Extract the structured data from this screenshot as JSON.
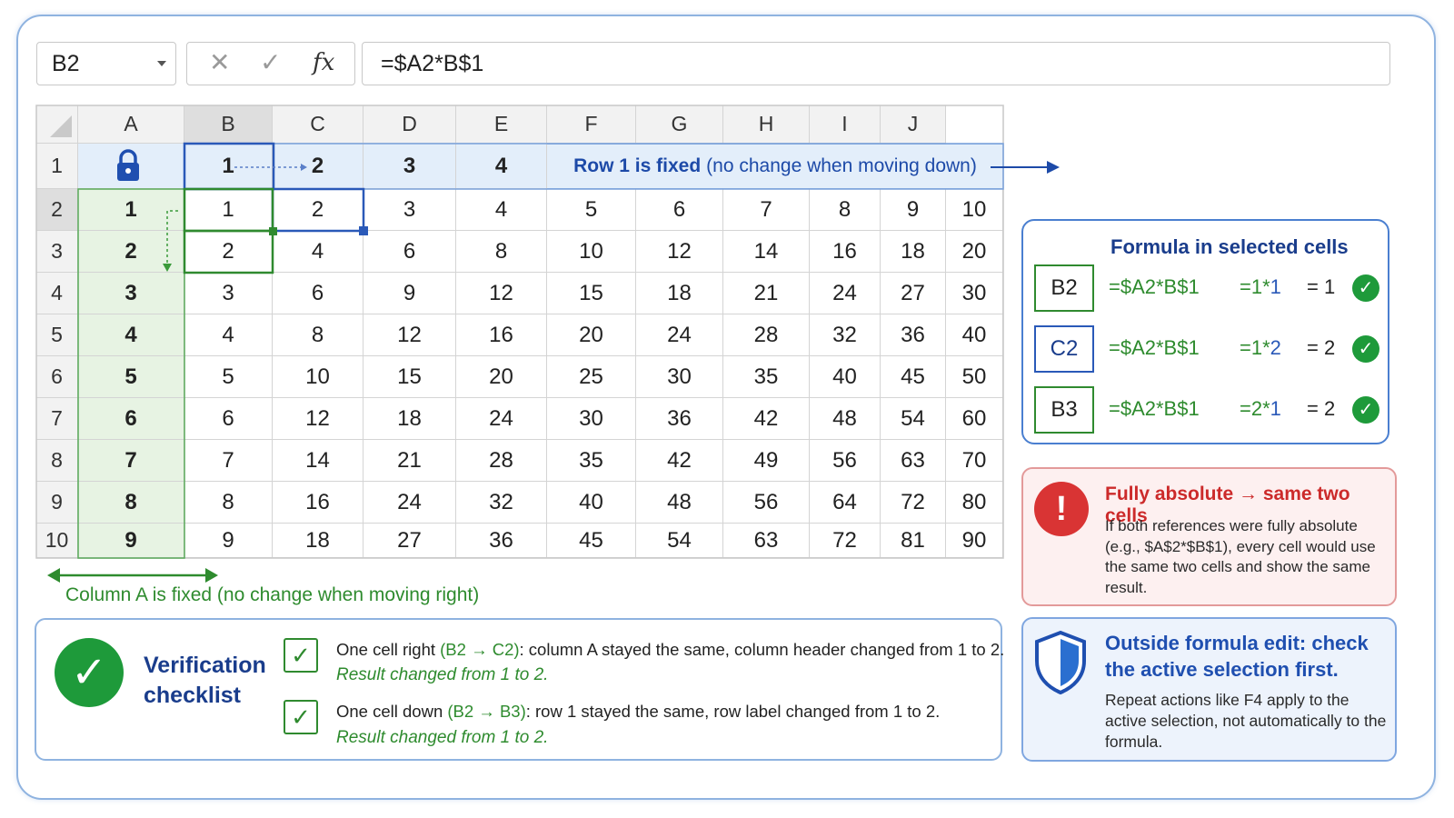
{
  "formula_bar": {
    "name_box": "B2",
    "cancel_icon": "✕",
    "enter_icon": "✓",
    "fx_label": "fx",
    "formula": "=$A2*B$1"
  },
  "grid": {
    "column_headers": [
      "A",
      "B",
      "C",
      "D",
      "E",
      "F",
      "G",
      "H",
      "I",
      "J"
    ],
    "row_headers": [
      "1",
      "2",
      "3",
      "4",
      "5",
      "6",
      "7",
      "8",
      "9",
      "10"
    ],
    "row1_values": [
      "1",
      "2",
      "3",
      "4"
    ],
    "row1_note_bold": "Row 1 is fixed",
    "row1_note_rest": "(no change when moving down)",
    "rows": [
      [
        "1",
        "1",
        "2",
        "3",
        "4",
        "5",
        "6",
        "7",
        "8",
        "9",
        "10"
      ],
      [
        "2",
        "2",
        "4",
        "6",
        "8",
        "10",
        "12",
        "14",
        "16",
        "18",
        "20"
      ],
      [
        "3",
        "3",
        "6",
        "9",
        "12",
        "15",
        "18",
        "21",
        "24",
        "27",
        "30"
      ],
      [
        "4",
        "4",
        "8",
        "12",
        "16",
        "20",
        "24",
        "28",
        "32",
        "36",
        "40"
      ],
      [
        "5",
        "5",
        "10",
        "15",
        "20",
        "25",
        "30",
        "35",
        "40",
        "45",
        "50"
      ],
      [
        "6",
        "6",
        "12",
        "18",
        "24",
        "30",
        "36",
        "42",
        "48",
        "54",
        "60"
      ],
      [
        "7",
        "7",
        "14",
        "21",
        "28",
        "35",
        "42",
        "49",
        "56",
        "63",
        "70"
      ],
      [
        "8",
        "8",
        "16",
        "24",
        "32",
        "40",
        "48",
        "56",
        "64",
        "72",
        "80"
      ],
      [
        "9",
        "9",
        "18",
        "27",
        "36",
        "45",
        "54",
        "63",
        "72",
        "81",
        "90"
      ]
    ],
    "column_a_note": "Column A is fixed (no change when moving right)"
  },
  "formula_panel": {
    "title": "Formula in selected cells",
    "rows": [
      {
        "ref": "B2",
        "formula": "=$A2*B$1",
        "eval_prefix": "=1*",
        "eval_last": "1",
        "result": "= 1"
      },
      {
        "ref": "C2",
        "formula": "=$A2*B$1",
        "eval_prefix": "=1*",
        "eval_last": "2",
        "result": "= 2"
      },
      {
        "ref": "B3",
        "formula": "=$A2*B$1",
        "eval_prefix": "=2*",
        "eval_last": "1",
        "result": "= 2"
      }
    ]
  },
  "warning_panel": {
    "title": "Fully absolute → same two cells",
    "text": "If both references were fully absolute (e.g., $A$2*$B$1), every cell would use the same two cells and show the same result."
  },
  "info_panel": {
    "title": "Outside formula edit: check the active selection first.",
    "text": "Repeat actions like F4 apply to the active selection, not automatically to the formula."
  },
  "verification": {
    "title": "Verification checklist",
    "items": [
      {
        "prefix": "One cell right ",
        "move": "(B2 → C2)",
        "suffix": ": column A stayed the same, column header changed from 1 to 2.",
        "result": "Result changed from 1 to 2."
      },
      {
        "prefix": "One cell down ",
        "move": "(B2 → B3)",
        "suffix": ": row 1 stayed the same, row label changed from 1 to 2.",
        "result": "Result changed from 1 to 2."
      }
    ]
  },
  "colors": {
    "accent_blue": "#1d4aa8",
    "accent_green": "#2e8b2e",
    "warning_red": "#d93434",
    "row1_fill": "#e3eefa",
    "colA_fill": "#e7f3e3"
  }
}
